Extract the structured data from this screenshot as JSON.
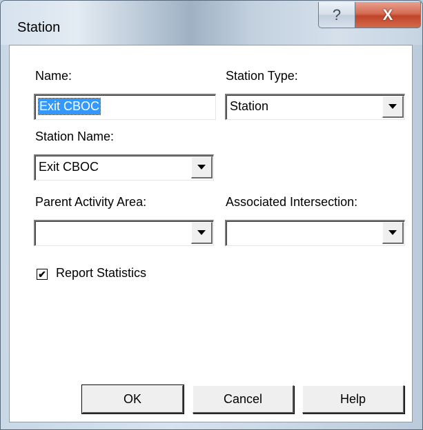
{
  "window": {
    "title": "Station"
  },
  "titlebar": {
    "help_glyph": "?",
    "close_glyph": "X"
  },
  "form": {
    "name_label": "Name:",
    "name_value": "Exit CBOC",
    "station_type_label": "Station Type:",
    "station_type_value": "Station",
    "station_name_label": "Station Name:",
    "station_name_value": "Exit CBOC",
    "parent_activity_area_label": "Parent Activity Area:",
    "parent_activity_area_value": "",
    "associated_intersection_label": "Associated Intersection:",
    "associated_intersection_value": "",
    "report_statistics_label": "Report Statistics",
    "report_statistics_checked": true,
    "check_glyph": "✔"
  },
  "buttons": {
    "ok": "OK",
    "cancel": "Cancel",
    "help": "Help"
  },
  "icons": {
    "dropdown": "chevron-down-icon",
    "help": "help-icon",
    "close": "close-icon",
    "check": "checkmark-icon"
  }
}
